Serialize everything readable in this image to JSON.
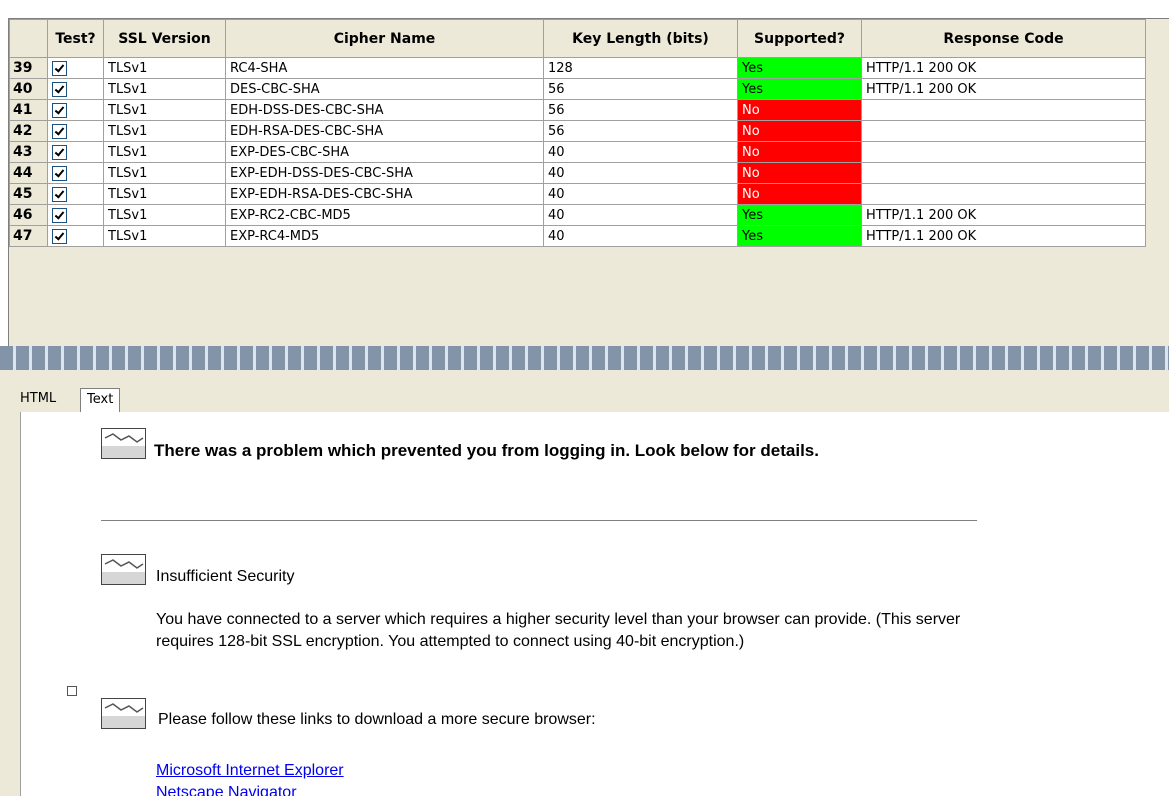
{
  "grid": {
    "columns": [
      "Test?",
      "SSL Version",
      "Cipher Name",
      "Key Length (bits)",
      "Supported?",
      "Response Code"
    ],
    "rows": [
      {
        "num": "39",
        "checked": true,
        "version": "TLSv1",
        "cipher": "RC4-SHA",
        "key": "128",
        "supported": "Yes",
        "response": "HTTP/1.1 200 OK"
      },
      {
        "num": "40",
        "checked": true,
        "version": "TLSv1",
        "cipher": "DES-CBC-SHA",
        "key": "56",
        "supported": "Yes",
        "response": "HTTP/1.1 200 OK"
      },
      {
        "num": "41",
        "checked": true,
        "version": "TLSv1",
        "cipher": "EDH-DSS-DES-CBC-SHA",
        "key": "56",
        "supported": "No",
        "response": ""
      },
      {
        "num": "42",
        "checked": true,
        "version": "TLSv1",
        "cipher": "EDH-RSA-DES-CBC-SHA",
        "key": "56",
        "supported": "No",
        "response": ""
      },
      {
        "num": "43",
        "checked": true,
        "version": "TLSv1",
        "cipher": "EXP-DES-CBC-SHA",
        "key": "40",
        "supported": "No",
        "response": ""
      },
      {
        "num": "44",
        "checked": true,
        "version": "TLSv1",
        "cipher": "EXP-EDH-DSS-DES-CBC-SHA",
        "key": "40",
        "supported": "No",
        "response": ""
      },
      {
        "num": "45",
        "checked": true,
        "version": "TLSv1",
        "cipher": "EXP-EDH-RSA-DES-CBC-SHA",
        "key": "40",
        "supported": "No",
        "response": ""
      },
      {
        "num": "46",
        "checked": true,
        "version": "TLSv1",
        "cipher": "EXP-RC2-CBC-MD5",
        "key": "40",
        "supported": "Yes",
        "response": "HTTP/1.1 200 OK"
      },
      {
        "num": "47",
        "checked": true,
        "version": "TLSv1",
        "cipher": "EXP-RC4-MD5",
        "key": "40",
        "supported": "Yes",
        "response": "HTTP/1.1 200 OK"
      }
    ],
    "colors": {
      "yes": "#00ff00",
      "no": "#ff0000"
    }
  },
  "tabs": {
    "html": "HTML",
    "text": "Text",
    "active": "Text"
  },
  "browser": {
    "heading": "There was a problem which prevented you from logging in. Look below for details.",
    "section_title": "Insufficient Security",
    "section_body": "You have connected to a server which requires a higher security level than your browser can provide. (This server requires 128-bit SSL encryption. You attempted to connect using 40-bit encryption.)",
    "links_intro": "Please follow these links to download a more secure browser:",
    "links": [
      "Microsoft Internet Explorer",
      "Netscape Navigator"
    ]
  }
}
